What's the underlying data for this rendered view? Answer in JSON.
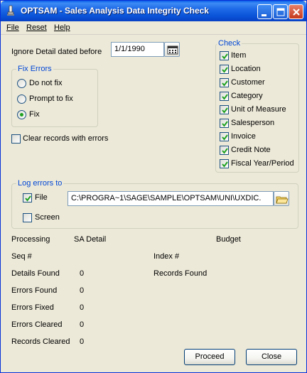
{
  "window": {
    "title": "OPTSAM - Sales Analysis Data Integrity Check"
  },
  "menu": {
    "file": "File",
    "reset": "Reset",
    "help": "Help"
  },
  "ignore_detail": {
    "label": "Ignore Detail dated before",
    "value": "1/1/1990"
  },
  "fix_errors": {
    "title": "Fix Errors",
    "options": [
      "Do not fix",
      "Prompt to fix",
      "Fix"
    ],
    "selected": "Fix"
  },
  "clear_records": {
    "label": "Clear records with errors",
    "checked": false
  },
  "check": {
    "title": "Check",
    "items": [
      {
        "label": "Item",
        "checked": true
      },
      {
        "label": "Location",
        "checked": true
      },
      {
        "label": "Customer",
        "checked": true
      },
      {
        "label": "Category",
        "checked": true
      },
      {
        "label": "Unit of Measure",
        "checked": true
      },
      {
        "label": "Salesperson",
        "checked": true
      },
      {
        "label": "Invoice",
        "checked": true
      },
      {
        "label": "Credit Note",
        "checked": true
      },
      {
        "label": "Fiscal Year/Period",
        "checked": true
      }
    ]
  },
  "log_errors": {
    "title": "Log errors to",
    "file_label": "File",
    "file_checked": true,
    "file_path": "C:\\PROGRA~1\\SAGE\\SAMPLE\\OPTSAM\\UNI\\UXDIC.",
    "screen_label": "Screen",
    "screen_checked": false
  },
  "status": {
    "processing_label": "Processing",
    "processing_value": "SA Detail",
    "budget_label": "Budget",
    "seq_label": "Seq #",
    "index_label": "Index #",
    "details_found_label": "Details Found",
    "details_found_value": "0",
    "records_found_label": "Records Found",
    "errors_found_label": "Errors Found",
    "errors_found_value": "0",
    "errors_fixed_label": "Errors Fixed",
    "errors_fixed_value": "0",
    "errors_cleared_label": "Errors Cleared",
    "errors_cleared_value": "0",
    "records_cleared_label": "Records Cleared",
    "records_cleared_value": "0"
  },
  "buttons": {
    "proceed": "Proceed",
    "close": "Close"
  }
}
